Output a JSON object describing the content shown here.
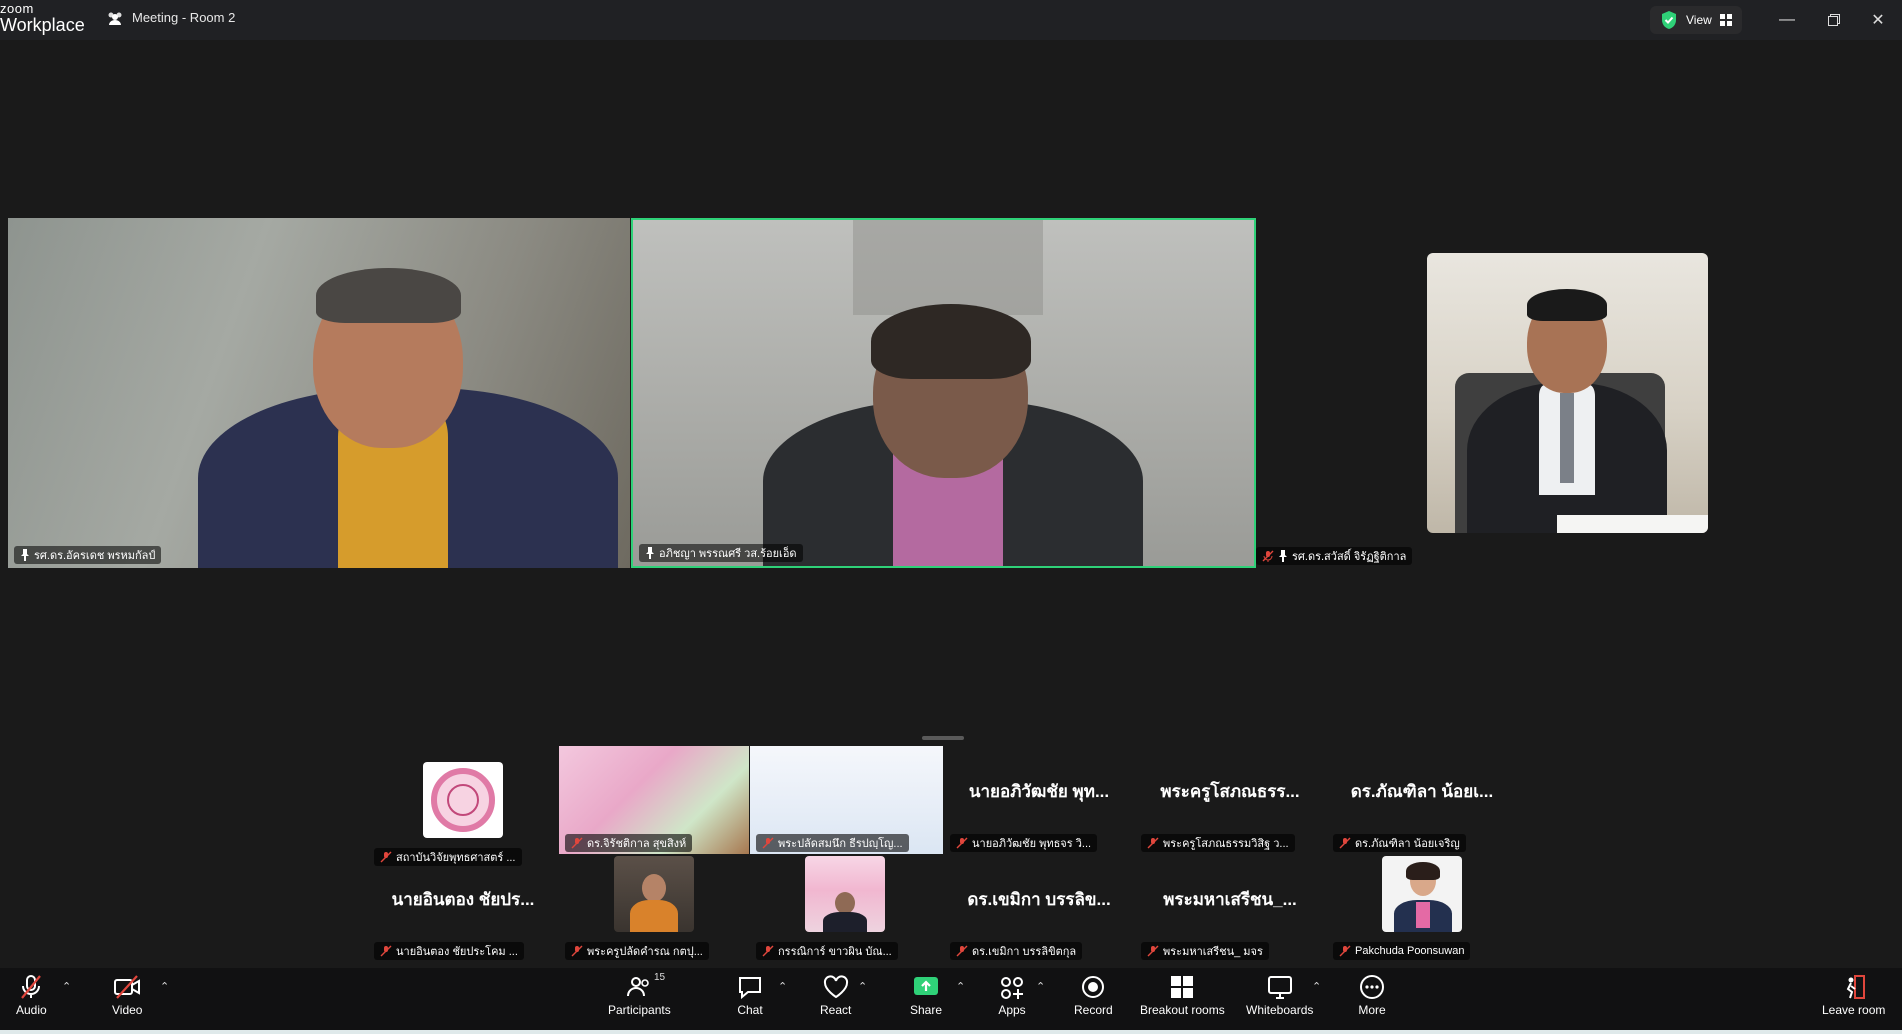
{
  "app": {
    "logo_small": "zoom",
    "logo_big": "Workplace"
  },
  "meeting": {
    "title": "Meeting - Room 2"
  },
  "titlebar": {
    "view_label": "View"
  },
  "colors": {
    "active_speaker": "#2fd178",
    "mute_red": "#e0463c",
    "share_green": "#2fd178",
    "leave_red": "#e0463c"
  },
  "main_tiles": [
    {
      "name": "รศ.ดร.อัครเดช พรหมกัลป์",
      "pinned": true,
      "muted": false
    },
    {
      "name": "อภิชญา  พรรณศรี วส.ร้อยเอ็ด",
      "pinned": true,
      "muted": false,
      "active": true
    },
    {
      "name": "รศ.ดร.สวัสดิ์ จิรัฏฐิติกาล",
      "pinned": true,
      "muted": true
    }
  ],
  "gallery": [
    {
      "display": "",
      "label": "สถาบันวิจัยพุทธศาสตร์ ...",
      "type": "seal"
    },
    {
      "display": "",
      "label": "ดร.จิรัชติกาล สุขสิงห์",
      "type": "poster"
    },
    {
      "display": "",
      "label": "พระปลัดสมนึก ธีรปญฺโญ...",
      "type": "slide"
    },
    {
      "display": "นายอภิวัฒชัย พุท...",
      "label": "นายอภิวัฒชัย พุทธจร วิ...",
      "type": "text"
    },
    {
      "display": "พระครูโสภณธรร...",
      "label": "พระครูโสภณธรรมวิสิฐ ว...",
      "type": "text"
    },
    {
      "display": "ดร.ภัณฑิลา  น้อยเ...",
      "label": "ดร.ภัณฑิลา  น้อยเจริญ",
      "type": "text"
    },
    {
      "display": "นายอินตอง ชัยปร...",
      "label": "นายอินตอง ชัยประโคม ...",
      "type": "text"
    },
    {
      "display": "",
      "label": "พระครูปลัดคำรณ กตปุ...",
      "type": "monk"
    },
    {
      "display": "",
      "label": "กรรณิการ์ ขาวผิน บัณ...",
      "type": "banner"
    },
    {
      "display": "ดร.เขมิกา บรรลิข...",
      "label": "ดร.เขมิกา บรรลิขิตกุล",
      "type": "text"
    },
    {
      "display": "พระมหาเสรีชน_...",
      "label": "พระมหาเสรีชน_ มจร",
      "type": "text"
    },
    {
      "display": "",
      "label": "Pakchuda Poonsuwan",
      "type": "photo"
    }
  ],
  "toolbar": {
    "audio": "Audio",
    "video": "Video",
    "participants": "Participants",
    "participants_count": "15",
    "chat": "Chat",
    "react": "React",
    "share": "Share",
    "apps": "Apps",
    "record": "Record",
    "breakout": "Breakout rooms",
    "whiteboards": "Whiteboards",
    "more": "More",
    "leave": "Leave room"
  }
}
